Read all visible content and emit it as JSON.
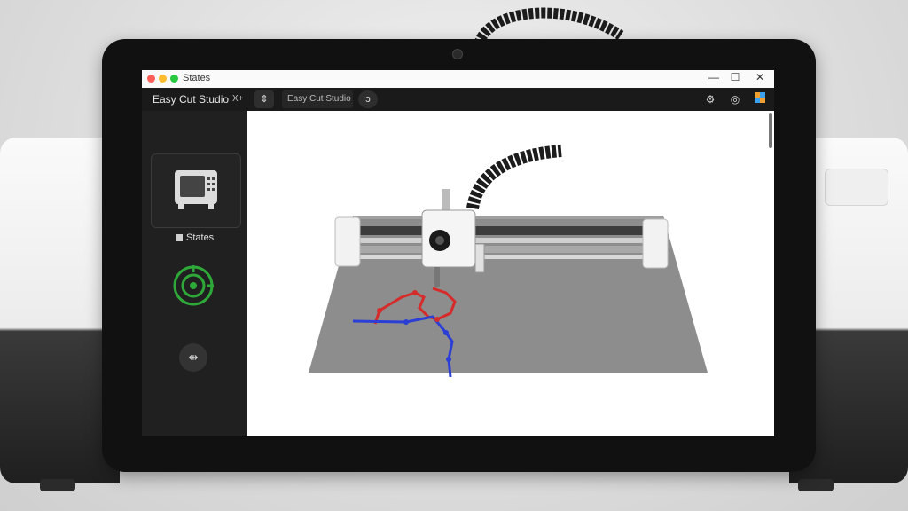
{
  "window": {
    "title": "States",
    "controls": {
      "minimize": "—",
      "maximize": "☐",
      "close": "✕"
    }
  },
  "toolbar": {
    "app_name": "Easy Cut Studio",
    "close_label": "X+",
    "tab_label": "Easy Cut Studio"
  },
  "sidebar": {
    "states_label": "States"
  },
  "icons": [
    "machine-icon",
    "target-icon",
    "swap-icon",
    "settings-icon",
    "search-icon",
    "color-palette-icon"
  ],
  "colors": {
    "accent_green": "#2fa83a",
    "path_red": "#d62b2b",
    "path_blue": "#2b3fd6",
    "canvas_bg": "#ffffff",
    "sidebar_bg": "#202020"
  }
}
